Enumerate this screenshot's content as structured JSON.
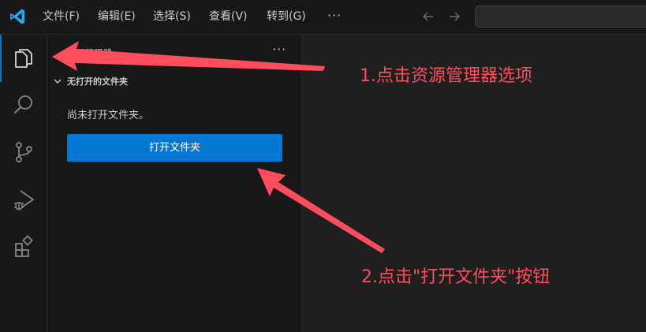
{
  "menu": {
    "items": [
      {
        "label": "文件(F)"
      },
      {
        "label": "编辑(E)"
      },
      {
        "label": "选择(S)"
      },
      {
        "label": "查看(V)"
      },
      {
        "label": "转到(G)"
      }
    ],
    "more": "···"
  },
  "activity_bar": {
    "items": [
      {
        "icon": "files-icon",
        "active": true
      },
      {
        "icon": "search-icon",
        "active": false
      },
      {
        "icon": "source-control-icon",
        "active": false
      },
      {
        "icon": "run-debug-icon",
        "active": false
      },
      {
        "icon": "extensions-icon",
        "active": false
      }
    ]
  },
  "sidebar": {
    "title": "资源管理器",
    "more": "···",
    "section_title": "无打开的文件夹",
    "empty_message": "尚未打开文件夹。",
    "open_folder_button": "打开文件夹"
  },
  "annotations": {
    "step1": "1.点击资源管理器选项",
    "step2": "2.点击\"打开文件夹\"按钮"
  },
  "colors": {
    "accent": "#0078d4",
    "annotation": "#ff4d5e",
    "logo": "#23a9f2"
  }
}
